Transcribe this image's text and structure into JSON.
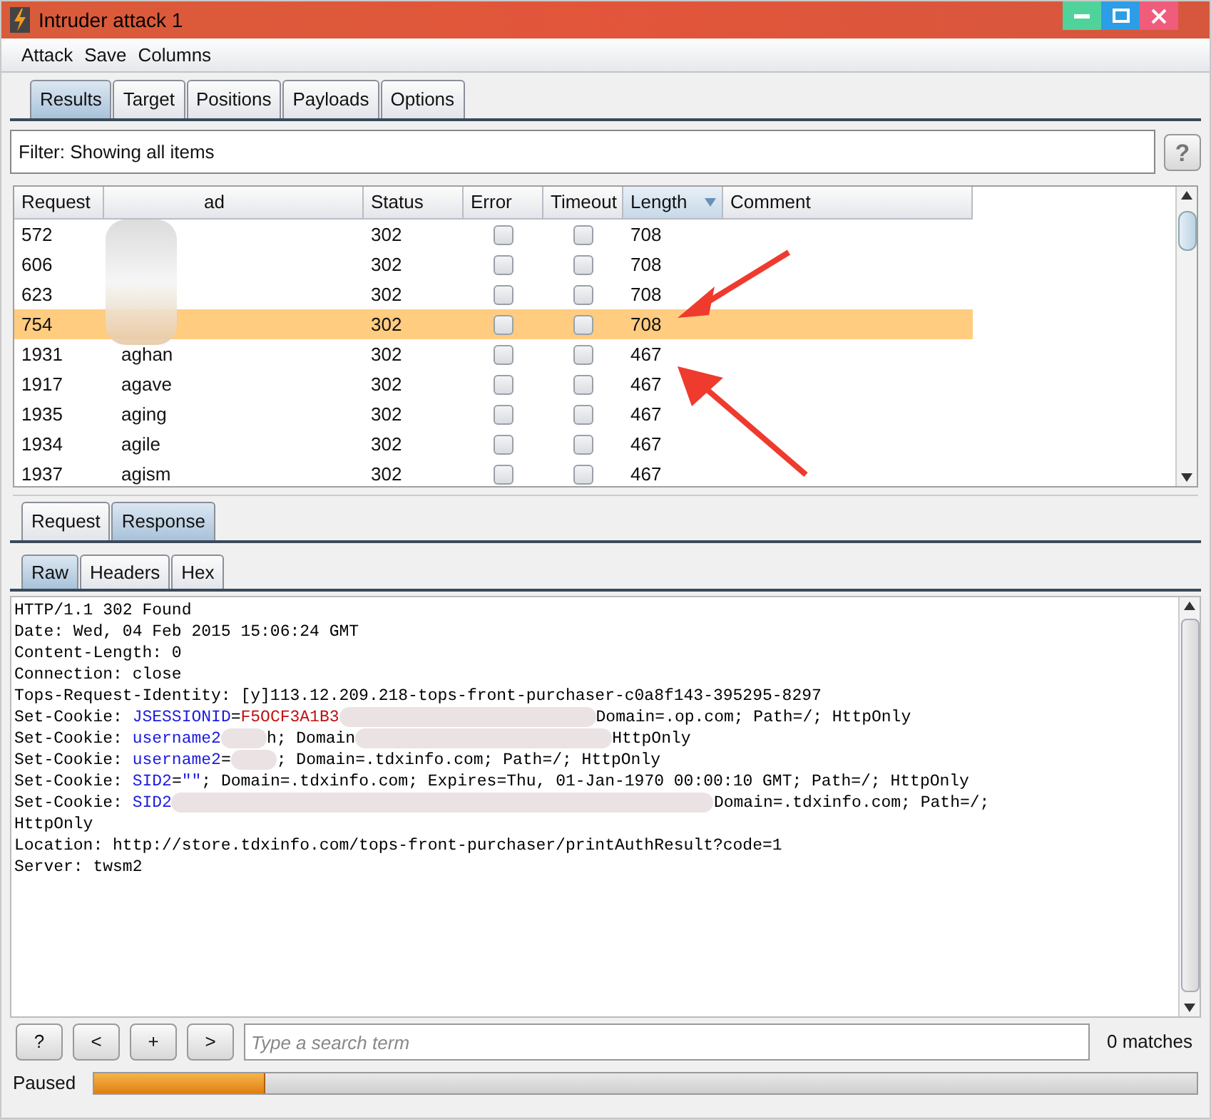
{
  "window": {
    "title": "Intruder attack 1"
  },
  "menu": [
    "Attack",
    "Save",
    "Columns"
  ],
  "tabs": [
    {
      "label": "Results",
      "selected": true
    },
    {
      "label": "Target",
      "selected": false
    },
    {
      "label": "Positions",
      "selected": false
    },
    {
      "label": "Payloads",
      "selected": false
    },
    {
      "label": "Options",
      "selected": false
    }
  ],
  "filter": {
    "text": "Filter: Showing all items",
    "help": "?"
  },
  "table": {
    "columns": [
      {
        "label": "Request",
        "sorted": false
      },
      {
        "label": "ad",
        "sorted": false
      },
      {
        "label": "Status",
        "sorted": false
      },
      {
        "label": "Error",
        "sorted": false
      },
      {
        "label": "Timeout",
        "sorted": false
      },
      {
        "label": "Length",
        "sorted": true
      },
      {
        "label": "Comment",
        "sorted": false
      }
    ],
    "rows": [
      {
        "request": "572",
        "status": "302",
        "error": false,
        "timeout": false,
        "length": "708",
        "selected": false
      },
      {
        "request": "606",
        "status": "302",
        "error": false,
        "timeout": false,
        "length": "708",
        "selected": false
      },
      {
        "request": "623",
        "status": "302",
        "error": false,
        "timeout": false,
        "length": "708",
        "selected": false
      },
      {
        "request": "754",
        "status": "302",
        "error": false,
        "timeout": false,
        "length": "708",
        "selected": true
      },
      {
        "request": "1931",
        "payload": "aghan",
        "status": "302",
        "error": false,
        "timeout": false,
        "length": "467",
        "selected": false
      },
      {
        "request": "1917",
        "payload": "agave",
        "status": "302",
        "error": false,
        "timeout": false,
        "length": "467",
        "selected": false
      },
      {
        "request": "1935",
        "payload": "aging",
        "status": "302",
        "error": false,
        "timeout": false,
        "length": "467",
        "selected": false
      },
      {
        "request": "1934",
        "payload": "agile",
        "status": "302",
        "error": false,
        "timeout": false,
        "length": "467",
        "selected": false
      },
      {
        "request": "1937",
        "payload": "agism",
        "status": "302",
        "error": false,
        "timeout": false,
        "length": "467",
        "selected": false
      }
    ]
  },
  "message_tabs": [
    {
      "label": "Request",
      "selected": false
    },
    {
      "label": "Response",
      "selected": true
    }
  ],
  "view_tabs": [
    {
      "label": "Raw",
      "selected": true
    },
    {
      "label": "Headers",
      "selected": false
    },
    {
      "label": "Hex",
      "selected": false
    }
  ],
  "response": {
    "lines": [
      [
        {
          "kind": "plain",
          "text": "HTTP/1.1 302 Found"
        }
      ],
      [
        {
          "kind": "plain",
          "text": "Date: Wed, 04 Feb 2015 15:06:24 GMT"
        }
      ],
      [
        {
          "kind": "plain",
          "text": "Content-Length: 0"
        }
      ],
      [
        {
          "kind": "plain",
          "text": "Connection: close"
        }
      ],
      [
        {
          "kind": "plain",
          "text": "Tops-Request-Identity: [y]113.12.209.218-tops-front-purchaser-c0a8f143-395295-8297"
        }
      ],
      [
        {
          "kind": "plain",
          "text": "Set-Cookie: "
        },
        {
          "kind": "name",
          "text": "JSESSIONID"
        },
        {
          "kind": "plain",
          "text": "="
        },
        {
          "kind": "value",
          "text": "F5OCF3A1B3"
        },
        {
          "kind": "blur_long"
        },
        {
          "kind": "plain",
          "text": "Domain=.op.com; Path=/; HttpOnly"
        }
      ],
      [
        {
          "kind": "plain",
          "text": "Set-Cookie: "
        },
        {
          "kind": "name",
          "text": "username2"
        },
        {
          "kind": "blur_short"
        },
        {
          "kind": "plain",
          "text": "h; Domain"
        },
        {
          "kind": "blur_long"
        },
        {
          "kind": "plain",
          "text": "HttpOnly"
        }
      ],
      [
        {
          "kind": "plain",
          "text": "Set-Cookie: "
        },
        {
          "kind": "name",
          "text": "username2"
        },
        {
          "kind": "plain",
          "text": "="
        },
        {
          "kind": "blur_short"
        },
        {
          "kind": "plain",
          "text": "; Domain=.tdxinfo.com; Path=/; HttpOnly"
        }
      ],
      [
        {
          "kind": "plain",
          "text": "Set-Cookie: "
        },
        {
          "kind": "name",
          "text": "SID2"
        },
        {
          "kind": "plain",
          "text": "="
        },
        {
          "kind": "name",
          "text": "\"\""
        },
        {
          "kind": "plain",
          "text": "; Domain=.tdxinfo.com; Expires=Thu, 01-Jan-1970 00:00:10 GMT; Path=/; HttpOnly"
        }
      ],
      [
        {
          "kind": "plain",
          "text": "Set-Cookie: "
        },
        {
          "kind": "name",
          "text": "SID2"
        },
        {
          "kind": "blur_wide"
        },
        {
          "kind": "plain",
          "text": "Domain=.tdxinfo.com; Path=/;"
        }
      ],
      [
        {
          "kind": "plain",
          "text": "HttpOnly"
        }
      ],
      [
        {
          "kind": "plain",
          "text": "Location: http://store.tdxinfo.com/tops-front-purchaser/printAuthResult?code=1"
        }
      ],
      [
        {
          "kind": "plain",
          "text": "Server: twsm2"
        }
      ]
    ]
  },
  "search": {
    "buttons": [
      "?",
      "<",
      "+",
      ">"
    ],
    "placeholder": "Type a search term",
    "matches": "0 matches"
  },
  "status": {
    "text": "Paused",
    "level": 0.155
  }
}
